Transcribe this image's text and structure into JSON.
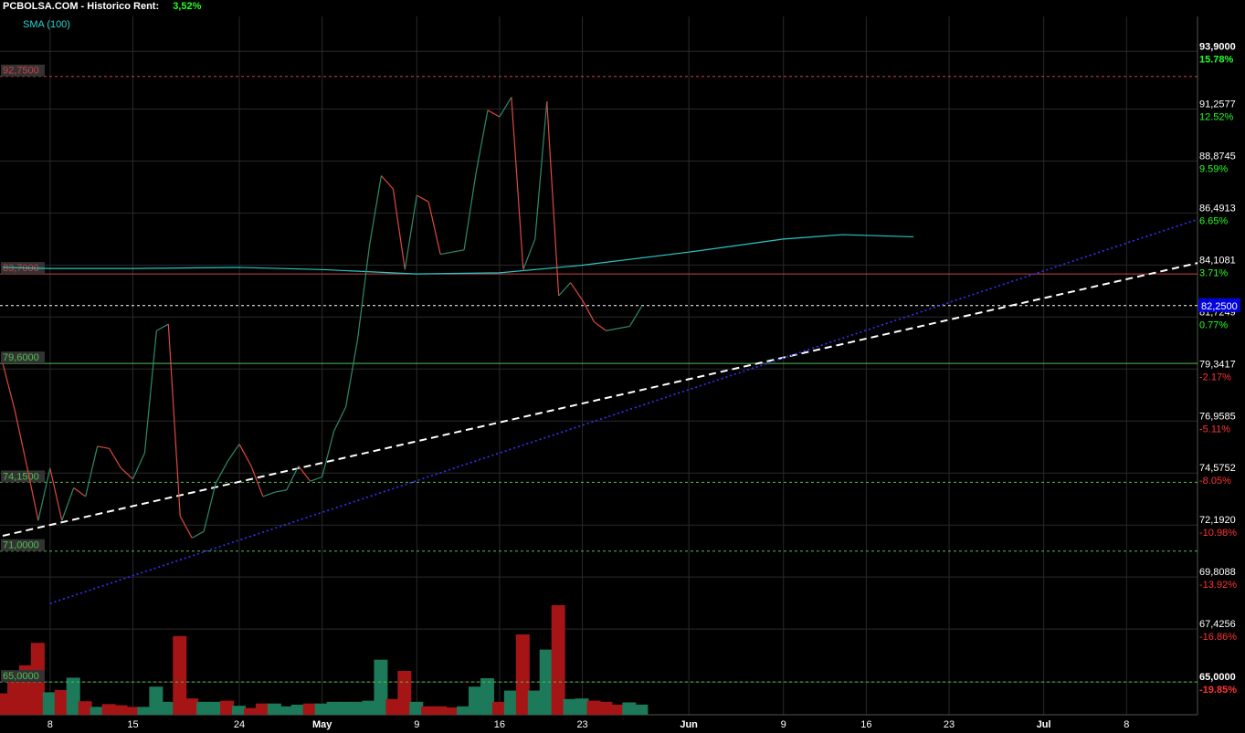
{
  "header": {
    "site": "PCBOLSA.COM - Historico",
    "rent_label": "Rent:",
    "rent_value": "3,52%"
  },
  "indicator_label": "SMA (100)",
  "colors": {
    "background": "#000000",
    "grid": "#2a2a2a",
    "up": "#2e8b6e",
    "down": "#e0483d",
    "volume_up": "#1c7a5a",
    "volume_down": "#a51515",
    "sma": "#29c6c6",
    "trend_white": "#ffffff",
    "trend_blue": "#3333ff",
    "resistance": "#d04040",
    "support": "#50c050",
    "last_price_bg": "#0000dd"
  },
  "chart_data": {
    "type": "line",
    "yrange": [
      63.5,
      95.5
    ],
    "x_domain": [
      "2024-04-04",
      "2024-07-14"
    ],
    "y_ticks": [
      {
        "value": 93.9,
        "label": "93,9000",
        "pct": "15.78%",
        "pct_color": "#22ff22"
      },
      {
        "value": 91.2577,
        "label": "91,2577",
        "pct": "12.52%",
        "pct_color": "#22ff22"
      },
      {
        "value": 88.8745,
        "label": "88,8745",
        "pct": "9.59%",
        "pct_color": "#22ff22"
      },
      {
        "value": 86.4913,
        "label": "86,4913",
        "pct": "6.65%",
        "pct_color": "#22ff22"
      },
      {
        "value": 84.1081,
        "label": "84,1081",
        "pct": "3.71%",
        "pct_color": "#22ff22"
      },
      {
        "value": 81.7249,
        "label": "81,7249",
        "pct": "0.77%",
        "pct_color": "#22ff22"
      },
      {
        "value": 79.3417,
        "label": "79,3417",
        "pct": "-2.17%",
        "pct_color": "#ff3333"
      },
      {
        "value": 76.9585,
        "label": "76,9585",
        "pct": "-5.11%",
        "pct_color": "#ff3333"
      },
      {
        "value": 74.5752,
        "label": "74,5752",
        "pct": "-8.05%",
        "pct_color": "#ff3333"
      },
      {
        "value": 72.192,
        "label": "72,1920",
        "pct": "-10.98%",
        "pct_color": "#ff3333"
      },
      {
        "value": 69.8088,
        "label": "69,8088",
        "pct": "-13.92%",
        "pct_color": "#ff3333"
      },
      {
        "value": 67.4256,
        "label": "67,4256",
        "pct": "-16.86%",
        "pct_color": "#ff3333"
      },
      {
        "value": 65.0,
        "label": "65,0000",
        "pct": "-19.85%",
        "pct_color": "#ff3333"
      }
    ],
    "x_ticks": [
      {
        "date": "2024-04-08",
        "label": "8",
        "bold": false
      },
      {
        "date": "2024-04-15",
        "label": "15",
        "bold": false
      },
      {
        "date": "2024-04-24",
        "label": "24",
        "bold": false
      },
      {
        "date": "2024-05-01",
        "label": "May",
        "bold": true
      },
      {
        "date": "2024-05-09",
        "label": "9",
        "bold": false
      },
      {
        "date": "2024-05-16",
        "label": "16",
        "bold": false
      },
      {
        "date": "2024-05-23",
        "label": "23",
        "bold": false
      },
      {
        "date": "2024-06-01",
        "label": "Jun",
        "bold": true
      },
      {
        "date": "2024-06-09",
        "label": "9",
        "bold": false
      },
      {
        "date": "2024-06-16",
        "label": "16",
        "bold": false
      },
      {
        "date": "2024-06-23",
        "label": "23",
        "bold": false
      },
      {
        "date": "2024-07-01",
        "label": "Jul",
        "bold": true
      },
      {
        "date": "2024-07-08",
        "label": "8",
        "bold": false
      }
    ],
    "price": [
      {
        "d": "2024-04-04",
        "c": 79.6
      },
      {
        "d": "2024-04-05",
        "c": 77.5
      },
      {
        "d": "2024-04-06",
        "c": 75.0
      },
      {
        "d": "2024-04-07",
        "c": 72.4
      },
      {
        "d": "2024-04-08",
        "c": 74.8
      },
      {
        "d": "2024-04-09",
        "c": 72.4
      },
      {
        "d": "2024-04-10",
        "c": 73.9
      },
      {
        "d": "2024-04-11",
        "c": 73.5
      },
      {
        "d": "2024-04-12",
        "c": 75.8
      },
      {
        "d": "2024-04-13",
        "c": 75.7
      },
      {
        "d": "2024-04-14",
        "c": 74.8
      },
      {
        "d": "2024-04-15",
        "c": 74.3
      },
      {
        "d": "2024-04-16",
        "c": 75.5
      },
      {
        "d": "2024-04-17",
        "c": 81.1
      },
      {
        "d": "2024-04-18",
        "c": 81.4
      },
      {
        "d": "2024-04-19",
        "c": 72.6
      },
      {
        "d": "2024-04-20",
        "c": 71.6
      },
      {
        "d": "2024-04-21",
        "c": 71.9
      },
      {
        "d": "2024-04-22",
        "c": 74.1
      },
      {
        "d": "2024-04-23",
        "c": 75.1
      },
      {
        "d": "2024-04-24",
        "c": 75.9
      },
      {
        "d": "2024-04-25",
        "c": 74.9
      },
      {
        "d": "2024-04-26",
        "c": 73.5
      },
      {
        "d": "2024-04-27",
        "c": 73.7
      },
      {
        "d": "2024-04-28",
        "c": 73.8
      },
      {
        "d": "2024-04-29",
        "c": 74.9
      },
      {
        "d": "2024-04-30",
        "c": 74.2
      },
      {
        "d": "2024-05-01",
        "c": 74.4
      },
      {
        "d": "2024-05-02",
        "c": 76.5
      },
      {
        "d": "2024-05-03",
        "c": 77.6
      },
      {
        "d": "2024-05-04",
        "c": 80.7
      },
      {
        "d": "2024-05-05",
        "c": 85.0
      },
      {
        "d": "2024-05-06",
        "c": 88.2
      },
      {
        "d": "2024-05-07",
        "c": 87.6
      },
      {
        "d": "2024-05-08",
        "c": 83.9
      },
      {
        "d": "2024-05-09",
        "c": 87.3
      },
      {
        "d": "2024-05-10",
        "c": 87.0
      },
      {
        "d": "2024-05-11",
        "c": 84.6
      },
      {
        "d": "2024-05-12",
        "c": 84.7
      },
      {
        "d": "2024-05-13",
        "c": 84.8
      },
      {
        "d": "2024-05-14",
        "c": 88.3
      },
      {
        "d": "2024-05-15",
        "c": 91.2
      },
      {
        "d": "2024-05-16",
        "c": 90.9
      },
      {
        "d": "2024-05-17",
        "c": 91.8
      },
      {
        "d": "2024-05-18",
        "c": 83.9
      },
      {
        "d": "2024-05-19",
        "c": 85.3
      },
      {
        "d": "2024-05-20",
        "c": 91.6
      },
      {
        "d": "2024-05-21",
        "c": 82.7
      },
      {
        "d": "2024-05-22",
        "c": 83.3
      },
      {
        "d": "2024-05-23",
        "c": 82.5
      },
      {
        "d": "2024-05-24",
        "c": 81.5
      },
      {
        "d": "2024-05-25",
        "c": 81.1
      },
      {
        "d": "2024-05-26",
        "c": 81.2
      },
      {
        "d": "2024-05-27",
        "c": 81.3
      },
      {
        "d": "2024-05-28",
        "c": 82.2
      }
    ],
    "sma_100": [
      {
        "d": "2024-04-04",
        "v": 84.0
      },
      {
        "d": "2024-04-08",
        "v": 83.95
      },
      {
        "d": "2024-04-15",
        "v": 83.95
      },
      {
        "d": "2024-04-24",
        "v": 84.0
      },
      {
        "d": "2024-05-01",
        "v": 83.9
      },
      {
        "d": "2024-05-09",
        "v": 83.7
      },
      {
        "d": "2024-05-16",
        "v": 83.75
      },
      {
        "d": "2024-05-23",
        "v": 84.1
      },
      {
        "d": "2024-06-01",
        "v": 84.7
      },
      {
        "d": "2024-06-09",
        "v": 85.3
      },
      {
        "d": "2024-06-14",
        "v": 85.5
      },
      {
        "d": "2024-06-20",
        "v": 85.4
      }
    ],
    "volume": [
      {
        "d": "2024-04-04",
        "v": 38,
        "up": false
      },
      {
        "d": "2024-04-05",
        "v": 62,
        "up": false
      },
      {
        "d": "2024-04-06",
        "v": 88,
        "up": false
      },
      {
        "d": "2024-04-07",
        "v": 128,
        "up": false
      },
      {
        "d": "2024-04-08",
        "v": 40,
        "up": true
      },
      {
        "d": "2024-04-09",
        "v": 44,
        "up": false
      },
      {
        "d": "2024-04-10",
        "v": 66,
        "up": true
      },
      {
        "d": "2024-04-11",
        "v": 24,
        "up": false
      },
      {
        "d": "2024-04-12",
        "v": 14,
        "up": true
      },
      {
        "d": "2024-04-13",
        "v": 19,
        "up": false
      },
      {
        "d": "2024-04-14",
        "v": 17,
        "up": false
      },
      {
        "d": "2024-04-15",
        "v": 14,
        "up": false
      },
      {
        "d": "2024-04-16",
        "v": 14,
        "up": true
      },
      {
        "d": "2024-04-17",
        "v": 50,
        "up": true
      },
      {
        "d": "2024-04-18",
        "v": 23,
        "up": true
      },
      {
        "d": "2024-04-19",
        "v": 140,
        "up": false
      },
      {
        "d": "2024-04-20",
        "v": 29,
        "up": false
      },
      {
        "d": "2024-04-21",
        "v": 23,
        "up": true
      },
      {
        "d": "2024-04-22",
        "v": 23,
        "up": true
      },
      {
        "d": "2024-04-23",
        "v": 25,
        "up": false
      },
      {
        "d": "2024-04-24",
        "v": 16,
        "up": true
      },
      {
        "d": "2024-04-25",
        "v": 12,
        "up": false
      },
      {
        "d": "2024-04-26",
        "v": 20,
        "up": false
      },
      {
        "d": "2024-04-27",
        "v": 20,
        "up": true
      },
      {
        "d": "2024-04-28",
        "v": 15,
        "up": true
      },
      {
        "d": "2024-04-29",
        "v": 18,
        "up": true
      },
      {
        "d": "2024-04-30",
        "v": 20,
        "up": false
      },
      {
        "d": "2024-05-01",
        "v": 20,
        "up": true
      },
      {
        "d": "2024-05-02",
        "v": 23,
        "up": true
      },
      {
        "d": "2024-05-03",
        "v": 23,
        "up": true
      },
      {
        "d": "2024-05-04",
        "v": 23,
        "up": true
      },
      {
        "d": "2024-05-05",
        "v": 25,
        "up": true
      },
      {
        "d": "2024-05-06",
        "v": 98,
        "up": true
      },
      {
        "d": "2024-05-07",
        "v": 28,
        "up": false
      },
      {
        "d": "2024-05-08",
        "v": 78,
        "up": false
      },
      {
        "d": "2024-05-09",
        "v": 23,
        "up": true
      },
      {
        "d": "2024-05-10",
        "v": 15,
        "up": false
      },
      {
        "d": "2024-05-11",
        "v": 15,
        "up": false
      },
      {
        "d": "2024-05-12",
        "v": 13,
        "up": false
      },
      {
        "d": "2024-05-13",
        "v": 15,
        "up": true
      },
      {
        "d": "2024-05-14",
        "v": 50,
        "up": true
      },
      {
        "d": "2024-05-15",
        "v": 65,
        "up": true
      },
      {
        "d": "2024-05-16",
        "v": 23,
        "up": false
      },
      {
        "d": "2024-05-17",
        "v": 43,
        "up": true
      },
      {
        "d": "2024-05-18",
        "v": 143,
        "up": false
      },
      {
        "d": "2024-05-19",
        "v": 43,
        "up": true
      },
      {
        "d": "2024-05-20",
        "v": 116,
        "up": true
      },
      {
        "d": "2024-05-21",
        "v": 195,
        "up": false
      },
      {
        "d": "2024-05-22",
        "v": 28,
        "up": true
      },
      {
        "d": "2024-05-23",
        "v": 29,
        "up": true
      },
      {
        "d": "2024-05-24",
        "v": 25,
        "up": false
      },
      {
        "d": "2024-05-25",
        "v": 23,
        "up": false
      },
      {
        "d": "2024-05-26",
        "v": 18,
        "up": false
      },
      {
        "d": "2024-05-27",
        "v": 22,
        "up": true
      },
      {
        "d": "2024-05-28",
        "v": 18,
        "up": true
      }
    ],
    "level_lines": [
      {
        "value": 92.75,
        "label": "92,7500",
        "style": "dotted",
        "color": "#d04040"
      },
      {
        "value": 83.7,
        "label": "83,7000",
        "style": "solid",
        "color": "#d04040"
      },
      {
        "value": 79.6,
        "label": "79,6000",
        "style": "solid",
        "color": "#50c050"
      },
      {
        "value": 74.15,
        "label": "74,1500",
        "style": "dotted",
        "color": "#50c050"
      },
      {
        "value": 71.0,
        "label": "71,0000",
        "style": "dotted",
        "color": "#50c050"
      },
      {
        "value": 65.0,
        "label": "65,0000",
        "style": "dotted",
        "color": "#50c050"
      }
    ],
    "last_price": {
      "value": 82.25,
      "label": "82,2500"
    },
    "trend_lines": [
      {
        "from": {
          "d": "2024-04-04",
          "v": 71.7
        },
        "to": {
          "d": "2024-07-14",
          "v": 84.2
        },
        "color": "#ffffff",
        "style": "dashed"
      },
      {
        "from": {
          "d": "2024-04-08",
          "v": 68.6
        },
        "to": {
          "d": "2024-07-14",
          "v": 86.2
        },
        "color": "#3333ff",
        "style": "dotted"
      }
    ]
  }
}
